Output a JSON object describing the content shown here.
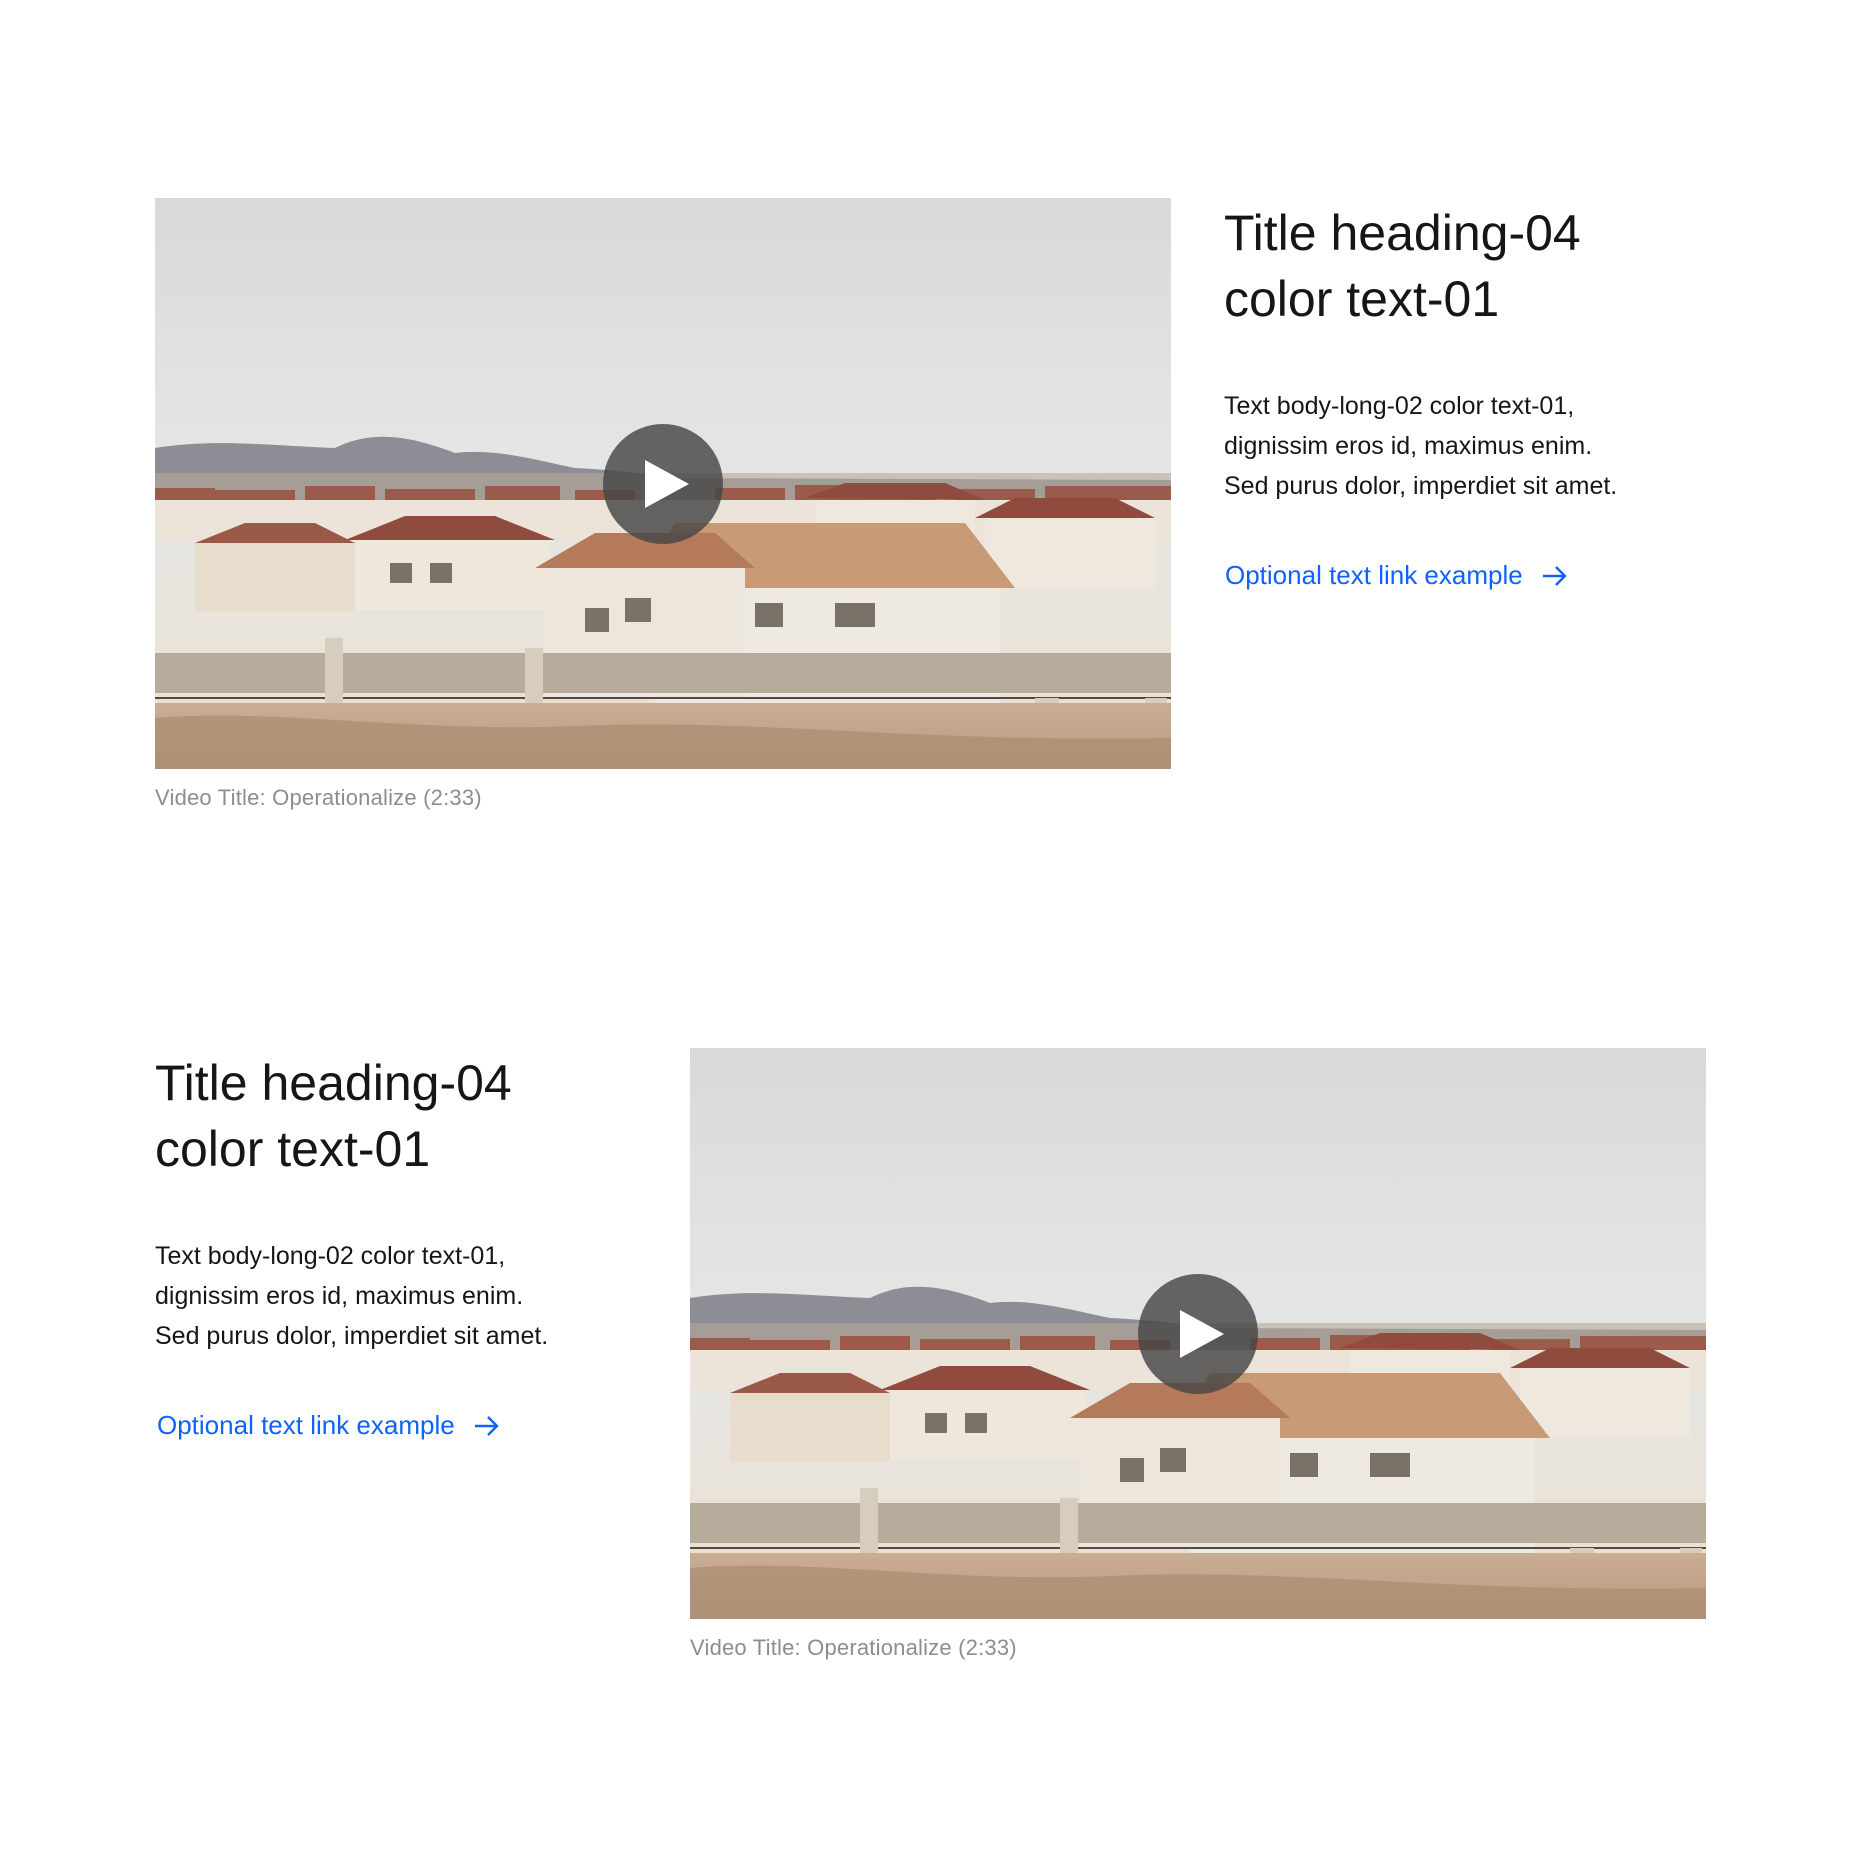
{
  "sections": [
    {
      "video": {
        "caption": "Video Title: Operationalize (2:33)"
      },
      "content": {
        "heading_line1": "Title heading-04",
        "heading_line2": "color text-01",
        "body_line1": "Text body-long-02 color text-01,",
        "body_line2": "dignissim eros id, maximus enim.",
        "body_line3": "Sed purus dolor, imperdiet sit amet.",
        "link_label": "Optional text link example"
      }
    },
    {
      "video": {
        "caption": "Video Title: Operationalize (2:33)"
      },
      "content": {
        "heading_line1": "Title heading-04",
        "heading_line2": "color text-01",
        "body_line1": "Text body-long-02 color text-01,",
        "body_line2": "dignissim eros id, maximus enim.",
        "body_line3": "Sed purus dolor, imperdiet sit amet.",
        "link_label": "Optional text link example"
      }
    }
  ],
  "icons": {
    "play": "play-icon",
    "link_arrow": "arrow-right-icon"
  },
  "colors": {
    "text_01": "#161616",
    "link": "#0f62fe",
    "caption": "#8d8d8d",
    "play_overlay": "#464646"
  }
}
